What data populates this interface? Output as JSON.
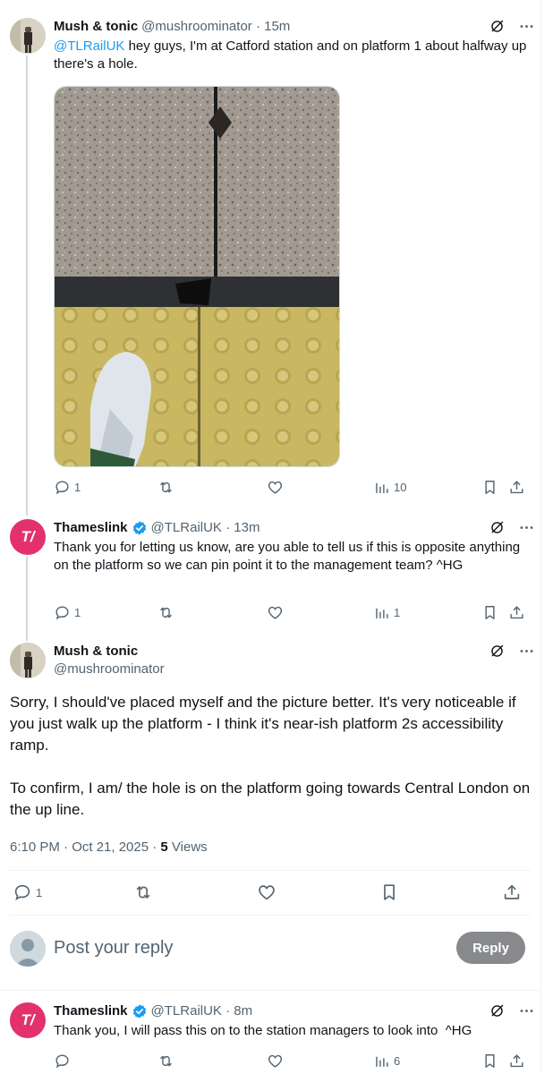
{
  "tweet1": {
    "name": "Mush & tonic",
    "handle": "@mushroominator · 15m",
    "mention": "@TLRailUK",
    "text": " hey guys, I'm at Catford station and on platform 1 about halfway up there's a hole.",
    "replies": "1",
    "views": "10"
  },
  "tweet2": {
    "name": "Thameslink",
    "handle": "@TLRailUK · 13m",
    "text": "Thank you for letting us know, are you able to tell us if this is opposite anything on the platform so we can pin point it to the management team? ^HG",
    "replies": "1",
    "views": "1"
  },
  "main": {
    "name": "Mush & tonic",
    "handle": "@mushroominator",
    "para1": "Sorry, I should've placed myself and the picture better. It's very noticeable if you just walk up the platform - I think it's near-ish platform 2s accessibility ramp.",
    "para2": "To confirm, I am/ the hole is on the platform going towards Central London on the up line.",
    "timestamp": "6:10 PM · Oct 21, 2025 · ",
    "views_count": "5",
    "views_label": " Views",
    "replies": "1"
  },
  "composer": {
    "placeholder": "Post your reply",
    "button": "Reply"
  },
  "tweet3": {
    "name": "Thameslink",
    "handle": "@TLRailUK · 8m",
    "text": "Thank you, I will pass this on to the station managers to look into  ^HG",
    "views": "6"
  },
  "avatar_tl_letter": "T/",
  "colors": {
    "accent": "#1d9bf0",
    "thameslink": "#e2316b",
    "muted": "#536471"
  },
  "icons": [
    "grok-icon",
    "more-icon",
    "reply-icon",
    "retweet-icon",
    "like-icon",
    "views-icon",
    "bookmark-icon",
    "share-icon",
    "verified-icon"
  ]
}
